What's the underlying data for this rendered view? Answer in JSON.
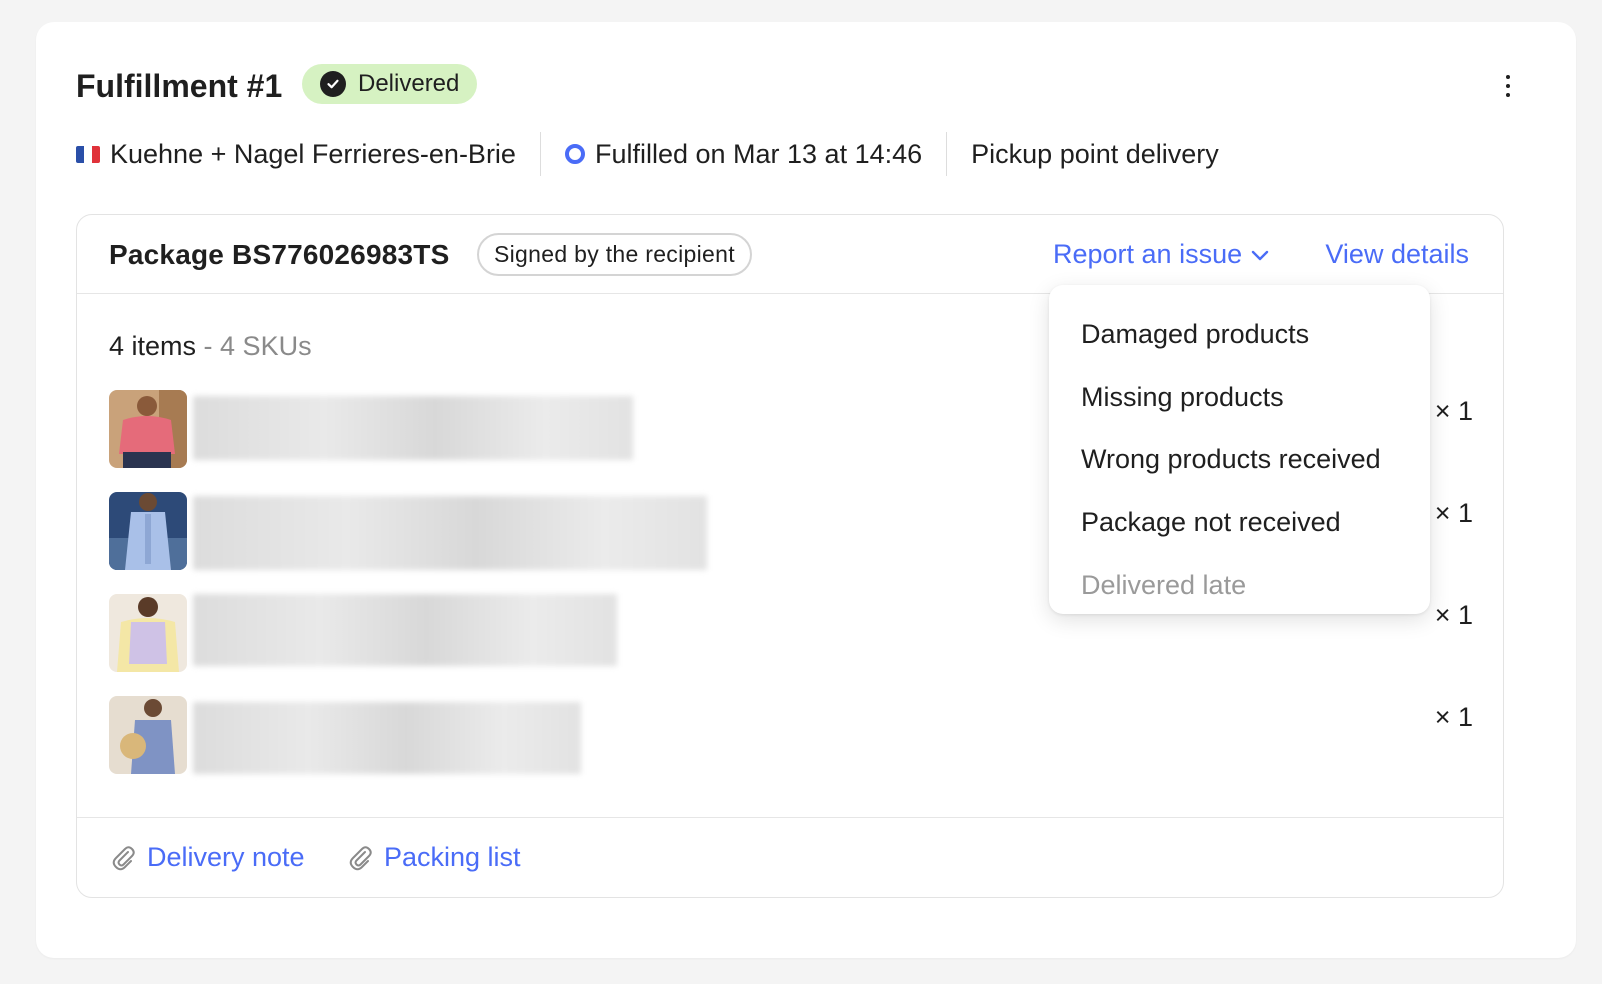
{
  "fulfillment": {
    "title": "Fulfillment #1",
    "status": "Delivered",
    "status_color": "#d6f2c2",
    "carrier": "Kuehne + Nagel Ferrieres-en-Brie",
    "carrier_flag": "france-flag",
    "fulfilled_text": "Fulfilled on Mar 13 at 14:46",
    "delivery_type": "Pickup point delivery"
  },
  "package": {
    "title": "Package BS776026983TS",
    "badge": "Signed by the recipient",
    "report_label": "Report an issue",
    "view_details_label": "View details",
    "items_count": "4 items",
    "skus_count": "- 4 SKUs",
    "items": [
      {
        "qty": "× 1",
        "name_blurred": true
      },
      {
        "qty": "× 1",
        "name_blurred": true
      },
      {
        "qty": "× 1",
        "name_blurred": true
      },
      {
        "qty": "× 1",
        "name_blurred": true
      }
    ],
    "attachments": [
      {
        "label": "Delivery note",
        "icon": "paperclip-icon"
      },
      {
        "label": "Packing list",
        "icon": "paperclip-icon"
      }
    ]
  },
  "report_menu": {
    "options": [
      {
        "label": "Damaged products",
        "enabled": true
      },
      {
        "label": "Missing products",
        "enabled": true
      },
      {
        "label": "Wrong products received",
        "enabled": true
      },
      {
        "label": "Package not received",
        "enabled": true
      },
      {
        "label": "Delivered late",
        "enabled": false
      }
    ]
  },
  "colors": {
    "accent": "#4a6cf7",
    "delivered_badge": "#d6f2c2",
    "muted_text": "#8a8a8a"
  }
}
